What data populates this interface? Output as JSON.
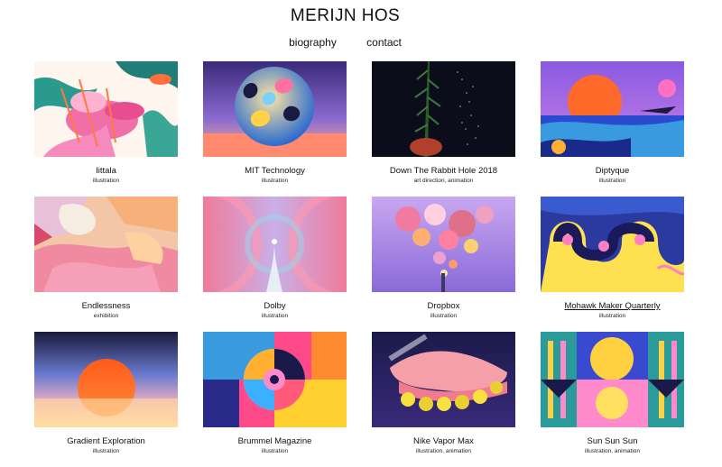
{
  "site": {
    "title": "MERIJN HOS"
  },
  "nav": {
    "items": [
      "biography",
      "contact"
    ]
  },
  "projects": [
    {
      "title": "Iittala",
      "tags": "illustration"
    },
    {
      "title": "MIT Technology",
      "tags": "illustration"
    },
    {
      "title": "Down The Rabbit Hole 2018",
      "tags": "art direction, animation"
    },
    {
      "title": "Diptyque",
      "tags": "illustration"
    },
    {
      "title": "Endlessness",
      "tags": "exhibition"
    },
    {
      "title": "Dolby",
      "tags": "illustration"
    },
    {
      "title": "Dropbox",
      "tags": "illustration"
    },
    {
      "title": "Mohawk Maker Quarterly",
      "tags": "illustration"
    },
    {
      "title": "Gradient Exploration",
      "tags": "illustration"
    },
    {
      "title": "Brummel Magazine",
      "tags": "illustration"
    },
    {
      "title": "Nike Vapor Max",
      "tags": "illustration, animation"
    },
    {
      "title": "Sun Sun Sun",
      "tags": "illustration, animation"
    }
  ]
}
